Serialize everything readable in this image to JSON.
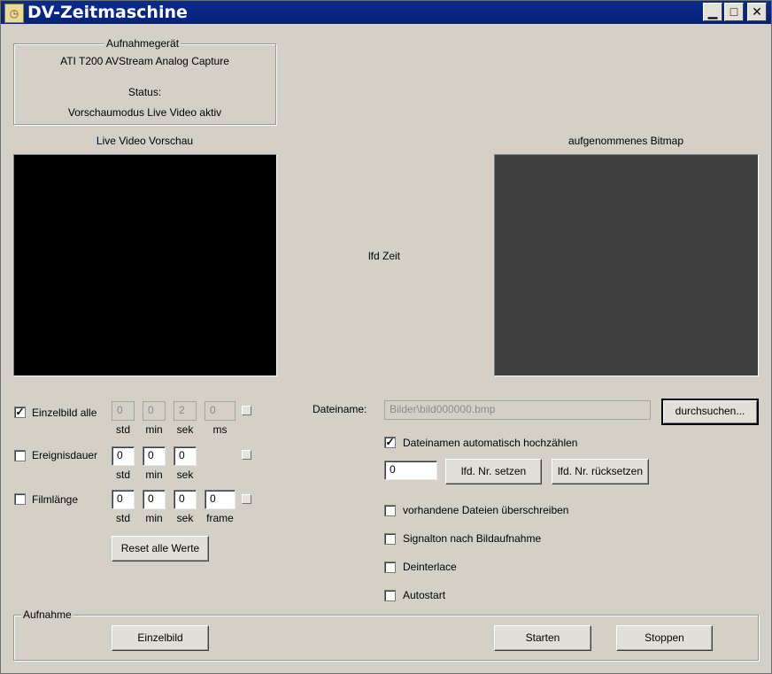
{
  "window": {
    "title": "DV-Zeitmaschine"
  },
  "device": {
    "group_title": "Aufnahmegerät",
    "name": "ATI T200 AVStream Analog Capture",
    "status_label": "Status:",
    "status_value": "Vorschaumodus Live Video aktiv"
  },
  "preview": {
    "live_label": "Live Video Vorschau",
    "captured_label": "aufgenommenes Bitmap",
    "time_label": "lfd Zeit",
    "live_color": "#000000",
    "captured_color": "#404040"
  },
  "timers": {
    "einzelbild": {
      "label": "Einzelbild alle",
      "checked": true,
      "values": [
        "0",
        "0",
        "2",
        "0"
      ],
      "units": [
        "std",
        "min",
        "sek",
        "ms"
      ]
    },
    "ereignisdauer": {
      "label": "Ereignisdauer",
      "checked": false,
      "values": [
        "0",
        "0",
        "0"
      ],
      "units": [
        "std",
        "min",
        "sek"
      ]
    },
    "filmlaenge": {
      "label": "Filmlänge",
      "checked": false,
      "values": [
        "0",
        "0",
        "0",
        "0"
      ],
      "units": [
        "std",
        "min",
        "sek",
        "frame"
      ]
    },
    "reset_label": "Reset alle Werte"
  },
  "file": {
    "label": "Dateiname:",
    "value": "Bilder\\bild000000.bmp",
    "browse_label": "durchsuchen...",
    "auto_increment_label": "Dateinamen automatisch hochzählen",
    "auto_increment_checked": true,
    "counter_value": "0",
    "set_nr_label": "lfd. Nr. setzen",
    "reset_nr_label": "lfd. Nr. rücksetzen"
  },
  "options": [
    {
      "label": "vorhandene Dateien überschreiben",
      "checked": false
    },
    {
      "label": "Signalton nach Bildaufnahme",
      "checked": false
    },
    {
      "label": "Deinterlace",
      "checked": false
    },
    {
      "label": "Autostart",
      "checked": false
    }
  ],
  "capture": {
    "group_title": "Aufnahme",
    "single_label": "Einzelbild",
    "start_label": "Starten",
    "stop_label": "Stoppen"
  }
}
